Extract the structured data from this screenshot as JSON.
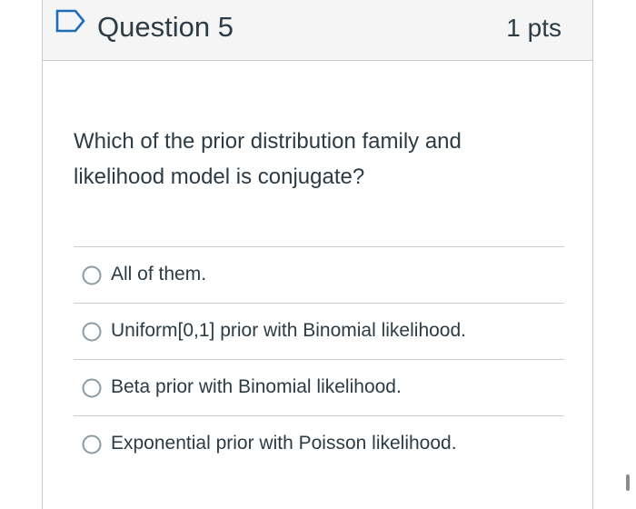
{
  "question": {
    "title": "Question 5",
    "points": "1 pts",
    "text": "Which of the prior distribution family and likelihood model is conjugate?",
    "flag_icon": "flag-outline-icon"
  },
  "answers": [
    {
      "label": "All of them.",
      "selected": false
    },
    {
      "label": "Uniform[0,1] prior with Binomial likelihood.",
      "selected": false
    },
    {
      "label": "Beta prior with Binomial likelihood.",
      "selected": false
    },
    {
      "label": "Exponential prior with Poisson likelihood.",
      "selected": false
    }
  ],
  "colors": {
    "header_bg": "#f5f5f5",
    "border": "#c7cdd1",
    "text": "#2d3b45",
    "flag": "#1f6db7",
    "radio": "#8b9aa3"
  }
}
